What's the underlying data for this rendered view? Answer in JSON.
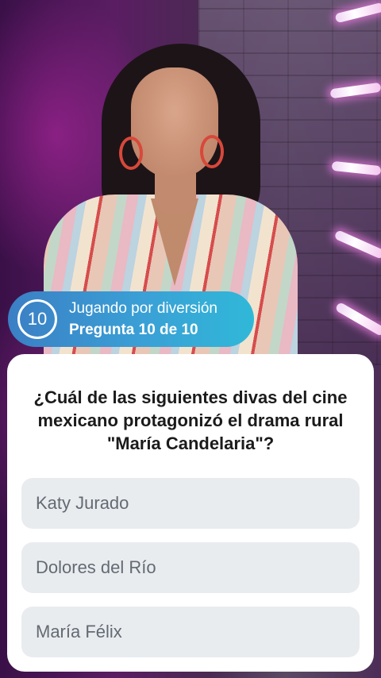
{
  "video": {
    "description_icon": "video-frame",
    "accent_colors": {
      "neon": "#ffffff",
      "background": "#4a1d55"
    }
  },
  "status": {
    "question_number": "10",
    "mode_label": "Jugando por diversión",
    "progress_label": "Pregunta 10 de 10",
    "pill_color": "#3aa0d6"
  },
  "question": {
    "text": "¿Cuál de las siguientes divas del cine mexicano protagonizó el drama rural \"María Candelaria\"?"
  },
  "answers": [
    {
      "label": "Katy Jurado"
    },
    {
      "label": "Dolores del Río"
    },
    {
      "label": "María Félix"
    }
  ]
}
